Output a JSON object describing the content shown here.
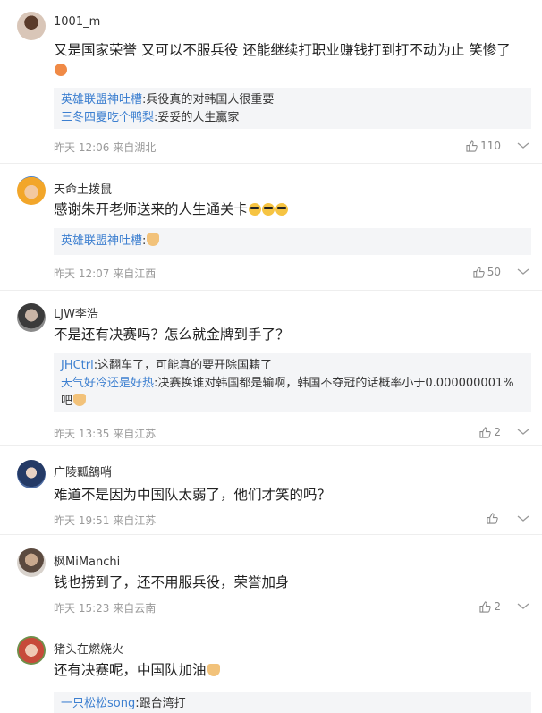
{
  "comments": [
    {
      "username": "1001_m",
      "text": "又是国家荣誉 又可以不服兵役 还能继续打职业赚钱打到打不动为止 笑惨了",
      "emoji": "grin-emoji",
      "replies": [
        {
          "user": "英雄联盟神吐槽",
          "text": ":兵役真的对韩国人很重要"
        },
        {
          "user": "三冬四夏吃个鸭梨",
          "text": ":妥妥的人生赢家"
        }
      ],
      "time": "昨天 12:06 来自湖北",
      "likes": "110"
    },
    {
      "username": "天命土拨鼠",
      "text": "感谢朱开老师送来的人生通关卡",
      "emoji": "sunglasses-emoji",
      "replies": [
        {
          "user": "英雄联盟神吐槽",
          "text": ":"
        }
      ],
      "time": "昨天 12:07 来自江西",
      "likes": "50"
    },
    {
      "username": "LJW李浩",
      "text": "不是还有决赛吗？怎么就金牌到手了？",
      "replies": [
        {
          "user": "JHCtrl",
          "text": ":这翻车了，可能真的要开除国籍了"
        },
        {
          "user": "天气好冷还是好热",
          "text": ":决赛换谁对韩国都是输啊，韩国不夺冠的话概率小于0.000000001%吧"
        }
      ],
      "time": "昨天 13:35 来自江苏",
      "likes": "2"
    },
    {
      "username": "广陵瓤鵅哨",
      "text": "难道不是因为中国队太弱了，他们才笑的吗？",
      "replies": [],
      "time": "昨天 19:51 来自江苏",
      "likes": ""
    },
    {
      "username": "枫MiManchi",
      "text": "钱也捞到了，还不用服兵役，荣誉加身",
      "replies": [],
      "time": "昨天 15:23 来自云南",
      "likes": "2"
    },
    {
      "username": "猪头在燃烧火",
      "text": "还有决赛呢，中国队加油",
      "emoji": "cat-emoji",
      "replies": [
        {
          "user": "一只松松song",
          "text": ":跟台湾打"
        }
      ],
      "time": "",
      "likes": ""
    }
  ],
  "icons": {
    "like": "thumbs-up-icon",
    "more": "more-options-icon"
  },
  "colors": {
    "reply_user": "#3c7fd0",
    "reply_bg": "#f4f5f7",
    "meta": "#9a9a9a"
  }
}
